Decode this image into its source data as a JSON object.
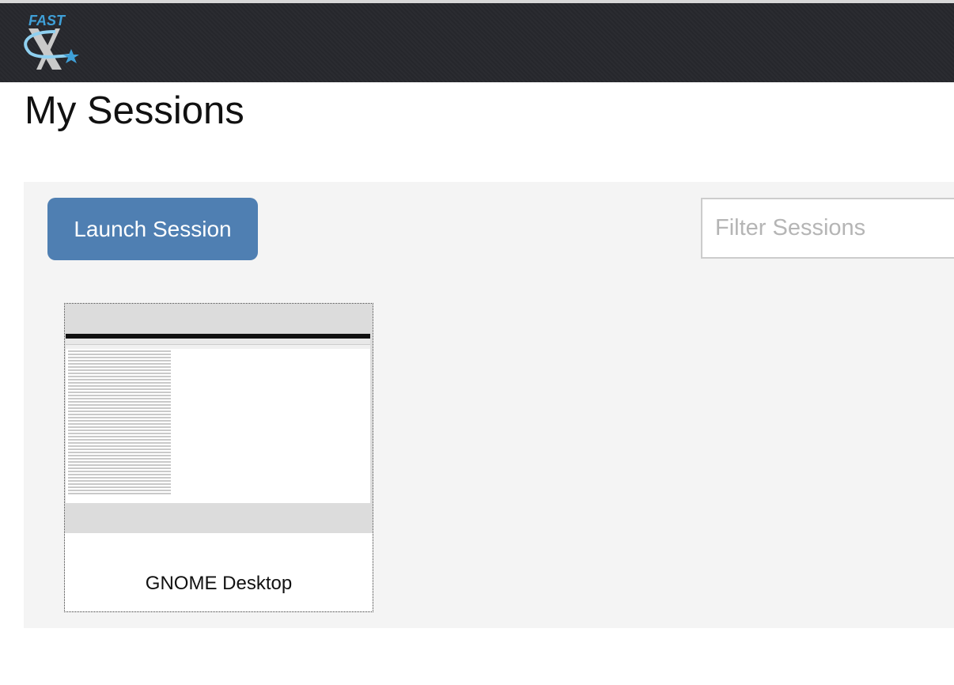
{
  "brand": {
    "logo_text": "FAST X"
  },
  "page": {
    "title": "My Sessions"
  },
  "toolbar": {
    "launch_label": "Launch Session",
    "filter_placeholder": "Filter Sessions"
  },
  "sessions": [
    {
      "name": "GNOME Desktop"
    }
  ],
  "colors": {
    "header": "#26272c",
    "accent": "#4f7fb2",
    "logo_blue": "#3fa0d8"
  }
}
